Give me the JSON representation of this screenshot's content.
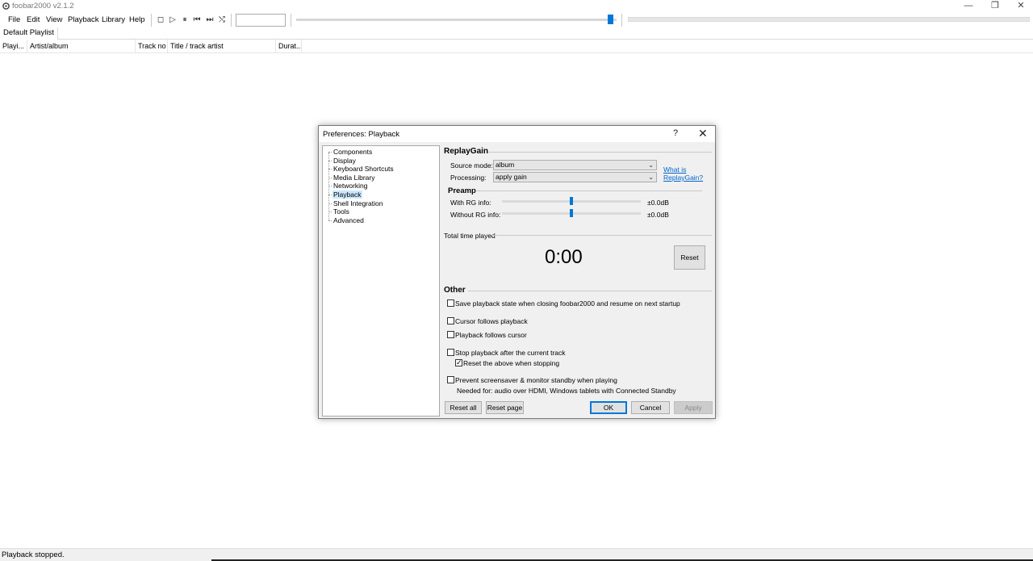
{
  "app": {
    "title": "foobar2000 v2.1.2"
  },
  "window_controls": {
    "minimize": "—",
    "restore": "❐",
    "close": "✕"
  },
  "menu": {
    "items": [
      "File",
      "Edit",
      "View",
      "Playback",
      "Library",
      "Help"
    ]
  },
  "toolbar": {
    "icons": {
      "stop": "stop-icon",
      "play": "play-icon",
      "pause": "pause-icon",
      "prev": "previous-icon",
      "next": "next-icon",
      "random": "random-icon"
    },
    "glyphs": {
      "stop": "◻",
      "play": "▷",
      "pause": "⏸",
      "prev": "⏮",
      "next": "⏭",
      "random": "⤭"
    },
    "seek_position": 0.98
  },
  "playlist": {
    "tabs": [
      "Default Playlist"
    ],
    "columns": [
      "Playi...",
      "Artist/album",
      "Track no",
      "Title / track artist",
      "Durat..."
    ]
  },
  "status": {
    "text": "Playback stopped."
  },
  "dialog": {
    "title": "Preferences: Playback",
    "help": "?",
    "close": "✕",
    "tree": [
      {
        "label": "Components",
        "selected": false
      },
      {
        "label": "Display",
        "selected": false
      },
      {
        "label": "Keyboard Shortcuts",
        "selected": false
      },
      {
        "label": "Media Library",
        "selected": false
      },
      {
        "label": "Networking",
        "selected": false
      },
      {
        "label": "Playback",
        "selected": true
      },
      {
        "label": "Shell Integration",
        "selected": false
      },
      {
        "label": "Tools",
        "selected": false
      },
      {
        "label": "Advanced",
        "selected": false
      }
    ],
    "replaygain": {
      "header": "ReplayGain",
      "source_mode_label": "Source mode:",
      "source_mode_value": "album",
      "processing_label": "Processing:",
      "processing_value": "apply gain",
      "what_is_link": "What is ReplayGain?",
      "what_is_line1": "What is",
      "what_is_line2": "ReplayGain?"
    },
    "preamp": {
      "header": "Preamp",
      "with_rg_label": "With RG info:",
      "with_rg_value": "±0.0dB",
      "with_rg_level": 0.5,
      "without_rg_label": "Without RG info:",
      "without_rg_value": "±0.0dB",
      "without_rg_level": 0.5
    },
    "total_time": {
      "header": "Total time played",
      "value": "0:00",
      "reset_label": "Reset"
    },
    "other": {
      "header": "Other",
      "options": [
        {
          "label": "Save playback state when closing foobar2000 and resume on next startup",
          "checked": false
        },
        {
          "label": "Cursor follows playback",
          "checked": false
        },
        {
          "label": "Playback follows cursor",
          "checked": false
        },
        {
          "label": "Stop playback after the current track",
          "checked": false
        },
        {
          "label": "Reset the above when stopping",
          "checked": true
        },
        {
          "label": "Prevent screensaver & monitor standby when playing",
          "checked": false
        }
      ],
      "note": "Needed for: audio over HDMI, Windows tablets with Connected Standby"
    },
    "buttons": {
      "reset_all": "Reset all",
      "reset_page": "Reset page",
      "ok": "OK",
      "cancel": "Cancel",
      "apply": "Apply"
    }
  }
}
